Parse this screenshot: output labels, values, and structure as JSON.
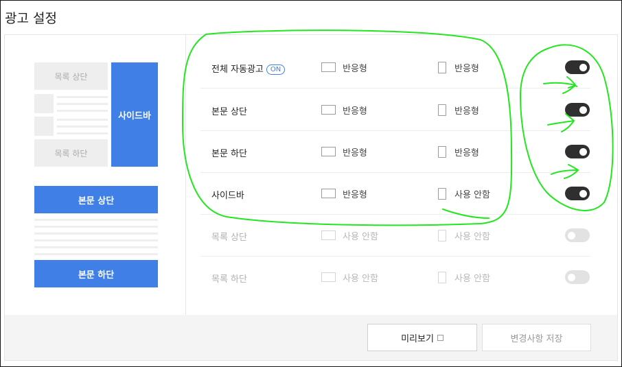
{
  "page": {
    "title": "광고 설정"
  },
  "preview": {
    "list_top": "목록 상단",
    "sidebar": "사이드바",
    "list_bottom": "목록 하단",
    "body_top": "본문 상단",
    "body_bottom": "본문 하단"
  },
  "rows": [
    {
      "label": "전체 자동광고",
      "badge": "ON",
      "pc": "반응형",
      "mobile": "반응형",
      "enabled": true
    },
    {
      "label": "본문 상단",
      "pc": "반응형",
      "mobile": "반응형",
      "enabled": true
    },
    {
      "label": "본문 하단",
      "pc": "반응형",
      "mobile": "반응형",
      "enabled": true
    },
    {
      "label": "사이드바",
      "pc": "반응형",
      "mobile": "사용 안함",
      "enabled": true
    },
    {
      "label": "목록 상단",
      "pc": "사용 안함",
      "mobile": "사용 안함",
      "enabled": false
    },
    {
      "label": "목록 하단",
      "pc": "사용 안함",
      "mobile": "사용 안함",
      "enabled": false
    }
  ],
  "footer": {
    "preview_label": "미리보기",
    "save_label": "변경사항 저장"
  },
  "colors": {
    "accent_blue": "#3f7fe6",
    "toggle_on": "#2f2f2f",
    "toggle_off": "#e2e2e2",
    "annotation_green": "#22e61e"
  }
}
